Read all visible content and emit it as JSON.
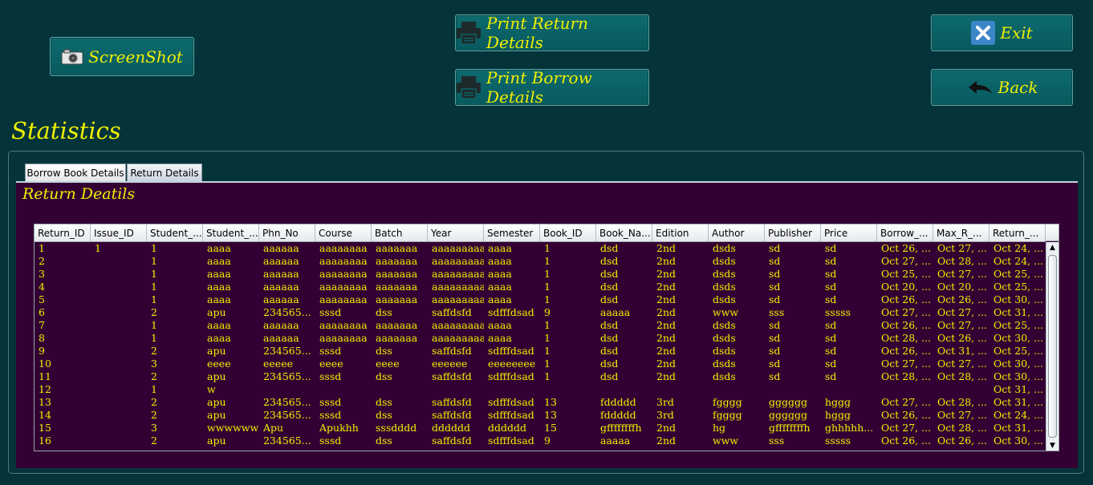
{
  "buttons": {
    "screenshot": "ScreenShot",
    "print_return": "Print Return Details",
    "print_borrow": "Print Borrow Details",
    "exit": "Exit",
    "back": "Back"
  },
  "title": "Statistics",
  "tabs": [
    {
      "label": "Borrow Book Details",
      "active": false
    },
    {
      "label": "Return Details",
      "active": true
    }
  ],
  "content_title": "Return Deatils",
  "colors": {
    "accent_text": "#f0f000",
    "background": "#04343a",
    "content_bg": "#330033"
  },
  "table": {
    "columns": [
      "Return_ID",
      "Issue_ID",
      "Student_...",
      "Student_...",
      "Phn_No",
      "Course",
      "Batch",
      "Year",
      "Semester",
      "Book_ID",
      "Book_Na...",
      "Edition",
      "Author",
      "Publisher",
      "Price",
      "Borrow_...",
      "Max_R_...",
      "Return_..."
    ],
    "rows": [
      [
        "1",
        "1",
        "1",
        "aaaa",
        "aaaaaa",
        "aaaaaaaa",
        "aaaaaaa",
        "aaaaaaaaa",
        "aaaa",
        "1",
        "dsd",
        "2nd",
        "dsds",
        "sd",
        "sd",
        "Oct 26, ...",
        "Oct 27, ...",
        "Oct 24, ..."
      ],
      [
        "2",
        "",
        "1",
        "aaaa",
        "aaaaaa",
        "aaaaaaaa",
        "aaaaaaa",
        "aaaaaaaaa",
        "aaaa",
        "1",
        "dsd",
        "2nd",
        "dsds",
        "sd",
        "sd",
        "Oct 27, ...",
        "Oct 28, ...",
        "Oct 24, ..."
      ],
      [
        "3",
        "",
        "1",
        "aaaa",
        "aaaaaa",
        "aaaaaaaa",
        "aaaaaaa",
        "aaaaaaaaa",
        "aaaa",
        "1",
        "dsd",
        "2nd",
        "dsds",
        "sd",
        "sd",
        "Oct 25, ...",
        "Oct 27, ...",
        "Oct 25, ..."
      ],
      [
        "4",
        "",
        "1",
        "aaaa",
        "aaaaaa",
        "aaaaaaaa",
        "aaaaaaa",
        "aaaaaaaaa",
        "aaaa",
        "1",
        "dsd",
        "2nd",
        "dsds",
        "sd",
        "sd",
        "Oct 20, ...",
        "Oct 20, ...",
        "Oct 25, ..."
      ],
      [
        "5",
        "",
        "1",
        "aaaa",
        "aaaaaa",
        "aaaaaaaa",
        "aaaaaaa",
        "aaaaaaaaa",
        "aaaa",
        "1",
        "dsd",
        "2nd",
        "dsds",
        "sd",
        "sd",
        "Oct 26, ...",
        "Oct 26, ...",
        "Oct 30, ..."
      ],
      [
        "6",
        "",
        "2",
        "apu",
        "234565...",
        "sssd",
        "dss",
        "saffdsfd",
        "sdfffdsad",
        "9",
        "aaaaa",
        "2nd",
        "www",
        "sss",
        "sssss",
        "Oct 27, ...",
        "Oct 27, ...",
        "Oct 31, ..."
      ],
      [
        "7",
        "",
        "1",
        "aaaa",
        "aaaaaa",
        "aaaaaaaa",
        "aaaaaaa",
        "aaaaaaaaa",
        "aaaa",
        "1",
        "dsd",
        "2nd",
        "dsds",
        "sd",
        "sd",
        "Oct 26, ...",
        "Oct 27, ...",
        "Oct 25, ..."
      ],
      [
        "8",
        "",
        "1",
        "aaaa",
        "aaaaaa",
        "aaaaaaaa",
        "aaaaaaa",
        "aaaaaaaaa",
        "aaaa",
        "1",
        "dsd",
        "2nd",
        "dsds",
        "sd",
        "sd",
        "Oct 28, ...",
        "Oct 26, ...",
        "Oct 30, ..."
      ],
      [
        "9",
        "",
        "2",
        "apu",
        "234565...",
        "sssd",
        "dss",
        "saffdsfd",
        "sdfffdsad",
        "1",
        "dsd",
        "2nd",
        "dsds",
        "sd",
        "sd",
        "Oct 26, ...",
        "Oct 31, ...",
        "Oct 25, ..."
      ],
      [
        "10",
        "",
        "3",
        "eeee",
        "eeeee",
        "eeee",
        "eeee",
        "eeeeee",
        "eeeeeeee",
        "1",
        "dsd",
        "2nd",
        "dsds",
        "sd",
        "sd",
        "Oct 27, ...",
        "Oct 27, ...",
        "Oct 30, ..."
      ],
      [
        "11",
        "",
        "2",
        "apu",
        "234565...",
        "sssd",
        "dss",
        "saffdsfd",
        "sdfffdsad",
        "1",
        "dsd",
        "2nd",
        "dsds",
        "sd",
        "sd",
        "Oct 28, ...",
        "Oct 28, ...",
        "Oct 30, ..."
      ],
      [
        "12",
        "",
        "1",
        "w",
        "",
        "",
        "",
        "",
        "",
        "",
        "",
        "",
        "",
        "",
        "",
        "",
        "",
        "Oct 31, ..."
      ],
      [
        "13",
        "",
        "2",
        "apu",
        "234565...",
        "sssd",
        "dss",
        "saffdsfd",
        "sdfffdsad",
        "13",
        "fddddd",
        "3rd",
        "fgggg",
        "gggggg",
        "hggg",
        "Oct 27, ...",
        "Oct 28, ...",
        "Oct 31, ..."
      ],
      [
        "14",
        "",
        "2",
        "apu",
        "234565...",
        "sssd",
        "dss",
        "saffdsfd",
        "sdfffdsad",
        "13",
        "fddddd",
        "3rd",
        "fgggg",
        "gggggg",
        "hggg",
        "Oct 26, ...",
        "Oct 27, ...",
        "Oct 24, ..."
      ],
      [
        "15",
        "",
        "3",
        "wwwwww",
        "Apu",
        "Apukhh",
        "sssdddd",
        "dddddd",
        "dddddd",
        "15",
        "gffffffffh",
        "2nd",
        "hg",
        "gffffffffh",
        "ghhhhh...",
        "Oct 27, ...",
        "Oct 28, ...",
        "Oct 31, ..."
      ],
      [
        "16",
        "",
        "2",
        "apu",
        "234565...",
        "sssd",
        "dss",
        "saffdsfd",
        "sdfffdsad",
        "9",
        "aaaaa",
        "2nd",
        "www",
        "sss",
        "sssss",
        "Oct 26, ...",
        "Oct 26, ...",
        "Oct 30, ..."
      ]
    ]
  },
  "scrollbar": {
    "up_arrow": "▲",
    "down_arrow": "▼"
  }
}
